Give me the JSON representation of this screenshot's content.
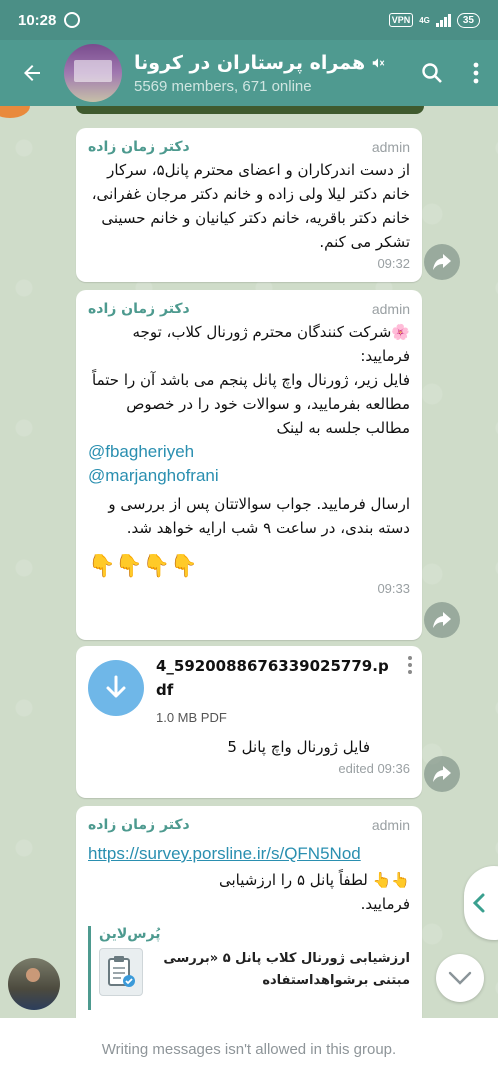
{
  "status_bar": {
    "time": "10:28",
    "vpn": "VPN",
    "network": "4G",
    "battery": "35"
  },
  "header": {
    "title": "همراه پرستاران در کرونا",
    "subtitle": "5569 members, 671 online"
  },
  "messages": [
    {
      "author": "دکتر زمان زاده",
      "badge": "admin",
      "text": "از دست اندرکاران و اعضای محترم پانل۵، سرکار خانم دکتر لیلا ولی زاده و خانم دکتر مرجان غفرانی، خانم دکتر باقریه، خانم دکتر کیانیان و خانم حسینی تشکر می کنم.",
      "time": "09:32"
    },
    {
      "author": "دکتر زمان زاده",
      "badge": "admin",
      "text_1": "🌸شرکت کنندگان محترم ژورنال کلاب، توجه فرمایید:\nفایل زیر، ژورنال واچ پانل پنجم می باشد آن را حتماً مطالعه بفرمایید، و سوالات خود را در خصوص مطالب جلسه به لینک",
      "link_1": "@fbagheriyeh",
      "link_2": "@marjanghofrani",
      "text_2": "ارسال فرمایید. جواب سوالاتتان پس از بررسی و دسته بندی، در ساعت ۹ شب ارایه خواهد شد.",
      "emojis": "👇👇👇👇",
      "time": "09:33"
    },
    {
      "file_name": "4_5920088676339025779.pdf",
      "file_size": "1.0 MB PDF",
      "caption": "فایل ژورنال واچ پانل 5",
      "time": "edited 09:36"
    },
    {
      "author": "دکتر زمان زاده",
      "badge": "admin",
      "link": "https://survey.porsline.ir/s/QFN5Nod",
      "text": "👆👆 لطفاً پانل ۵ را ارزشیابی فرمایید.",
      "preview_site": "پُرس‌لاین",
      "preview_text": "ارزشیابی ژورنال کلاب پانل ۵ «بررسی مبتنی برشواهداستفاده"
    }
  ],
  "footer": {
    "notice": "Writing messages isn't allowed in this group."
  },
  "colors": {
    "header": "#4f9a90",
    "status_bar": "#4b8f86",
    "accent": "#4d9a8f",
    "link": "#2a8fb0"
  },
  "icons": [
    "back-arrow-icon",
    "mute-icon",
    "search-icon",
    "more-vert-icon",
    "share-icon",
    "download-icon",
    "chevron-left-icon",
    "chevron-down-icon"
  ]
}
